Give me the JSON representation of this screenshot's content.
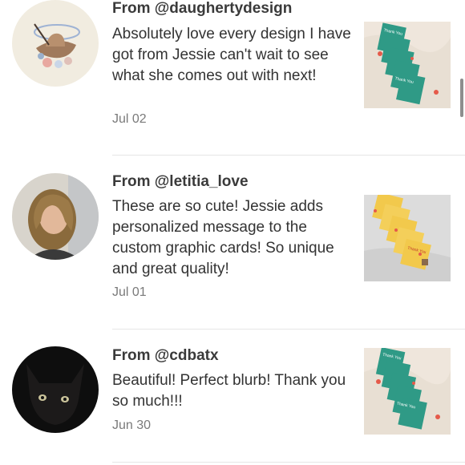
{
  "reviews": [
    {
      "author": "From @daughertydesign",
      "text": "Absolutely love every design I have got from Jessie can't wait to see what she comes out with next!",
      "date": "Jul 02",
      "thumb_card_text": "Thank You"
    },
    {
      "author": "From @letitia_love",
      "text": "These are so cute! Jessie adds personalized message to the custom graphic cards! So unique and great quality!",
      "date": "Jul 01",
      "thumb_card_text": "Thank You"
    },
    {
      "author": "From @cdbatx",
      "text": "Beautiful! Perfect blurb! Thank you so much!!!",
      "date": "Jun 30",
      "thumb_card_text": "Thank You"
    }
  ],
  "colors": {
    "teal_card": "#2f9a86",
    "yellow_card": "#f2c94c",
    "divider": "#e6e6e6",
    "date_text": "#7a7a7a"
  },
  "icons": {
    "avatar_1": "cowboy-hat-avatar",
    "avatar_2": "woman-portrait-avatar",
    "avatar_3": "black-cat-avatar"
  }
}
